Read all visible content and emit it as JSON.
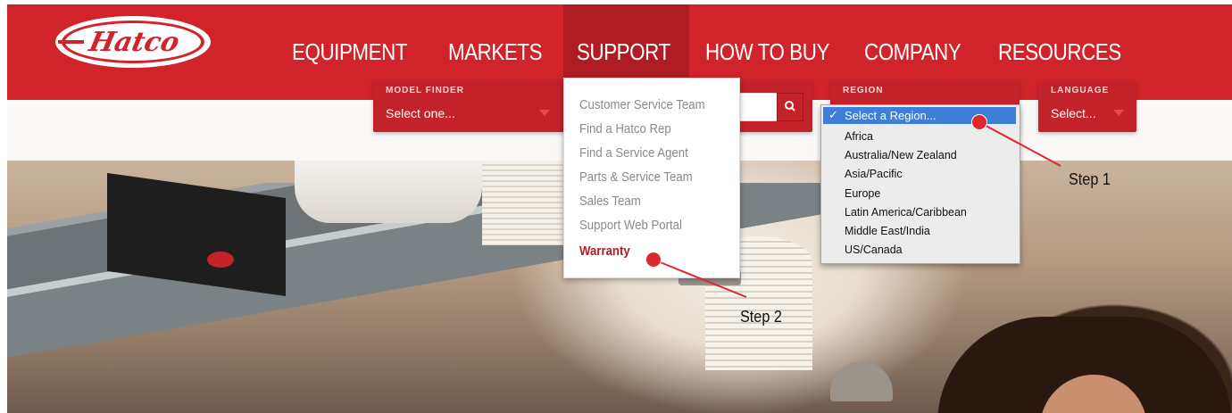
{
  "brand": {
    "logo_text": "Hatco",
    "colors": {
      "primary": "#d1232a",
      "active": "#b01c23",
      "select_highlight": "#3d7fd6",
      "annotation": "#e0262e"
    }
  },
  "nav": {
    "items": [
      "EQUIPMENT",
      "MARKETS",
      "SUPPORT",
      "HOW TO BUY",
      "COMPANY",
      "RESOURCES"
    ],
    "active": "SUPPORT"
  },
  "filters": {
    "model_finder": {
      "label": "MODEL FINDER",
      "value": "Select one..."
    },
    "region": {
      "label": "REGION"
    },
    "language": {
      "label": "LANGUAGE",
      "value": "Select..."
    }
  },
  "support_menu": {
    "items": [
      "Customer Service Team",
      "Find a Hatco Rep",
      "Find a Service Agent",
      "Parts & Service Team",
      "Sales Team",
      "Support Web Portal",
      "Warranty"
    ],
    "active": "Warranty"
  },
  "region_select": {
    "selected": "Select a Region...",
    "options": [
      "Africa",
      "Australia/New Zealand",
      "Asia/Pacific",
      "Europe",
      "Latin America/Caribbean",
      "Middle East/India",
      "US/Canada"
    ]
  },
  "annotations": {
    "step1": "Step 1",
    "step2": "Step 2"
  },
  "icons": {
    "search": "search-icon",
    "check": "checkmark-icon",
    "caret": "caret-down-icon"
  }
}
